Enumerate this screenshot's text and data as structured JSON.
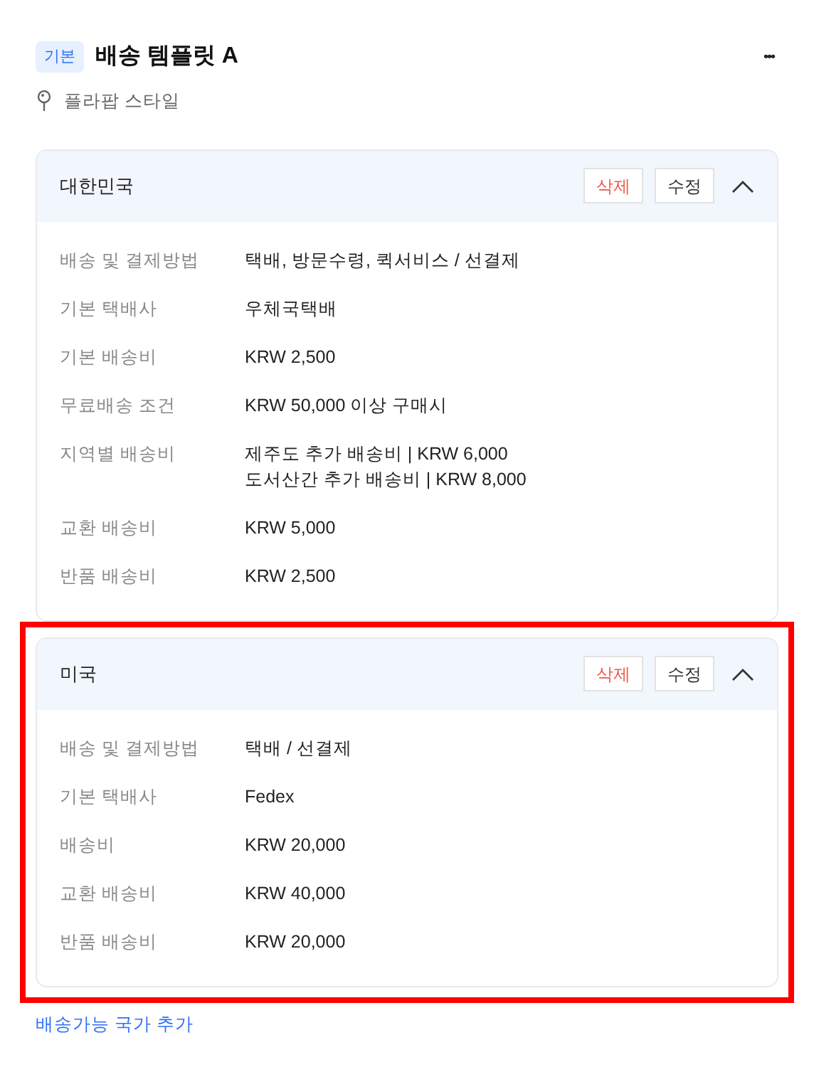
{
  "header": {
    "badge": "기본",
    "title": "배송 템플릿 A",
    "more": "•••",
    "store": "플라팝 스타일"
  },
  "countries": [
    {
      "name": "대한민국",
      "highlighted": false,
      "expanded": true,
      "delete": "삭제",
      "edit": "수정",
      "rows": [
        {
          "label": "배송 및 결제방법",
          "lines": [
            "택배, 방문수령, 퀵서비스 / 선결제"
          ]
        },
        {
          "label": "기본 택배사",
          "lines": [
            "우체국택배"
          ]
        },
        {
          "label": "기본 배송비",
          "lines": [
            "KRW 2,500"
          ]
        },
        {
          "label": "무료배송 조건",
          "lines": [
            "KRW 50,000 이상 구매시"
          ]
        },
        {
          "label": "지역별 배송비",
          "lines": [
            "제주도 추가 배송비 | KRW 6,000",
            "도서산간 추가 배송비 | KRW 8,000"
          ]
        },
        {
          "label": "교환 배송비",
          "lines": [
            "KRW 5,000"
          ]
        },
        {
          "label": "반품 배송비",
          "lines": [
            "KRW 2,500"
          ]
        }
      ]
    },
    {
      "name": "미국",
      "highlighted": true,
      "expanded": true,
      "delete": "삭제",
      "edit": "수정",
      "rows": [
        {
          "label": "배송 및 결제방법",
          "lines": [
            "택배 / 선결제"
          ]
        },
        {
          "label": "기본 택배사",
          "lines": [
            "Fedex"
          ]
        },
        {
          "label": "배송비",
          "lines": [
            "KRW 20,000"
          ]
        },
        {
          "label": "교환 배송비",
          "lines": [
            "KRW 40,000"
          ]
        },
        {
          "label": "반품 배송비",
          "lines": [
            "KRW 20,000"
          ]
        }
      ]
    }
  ],
  "add_link": "배송가능 국가 추가"
}
